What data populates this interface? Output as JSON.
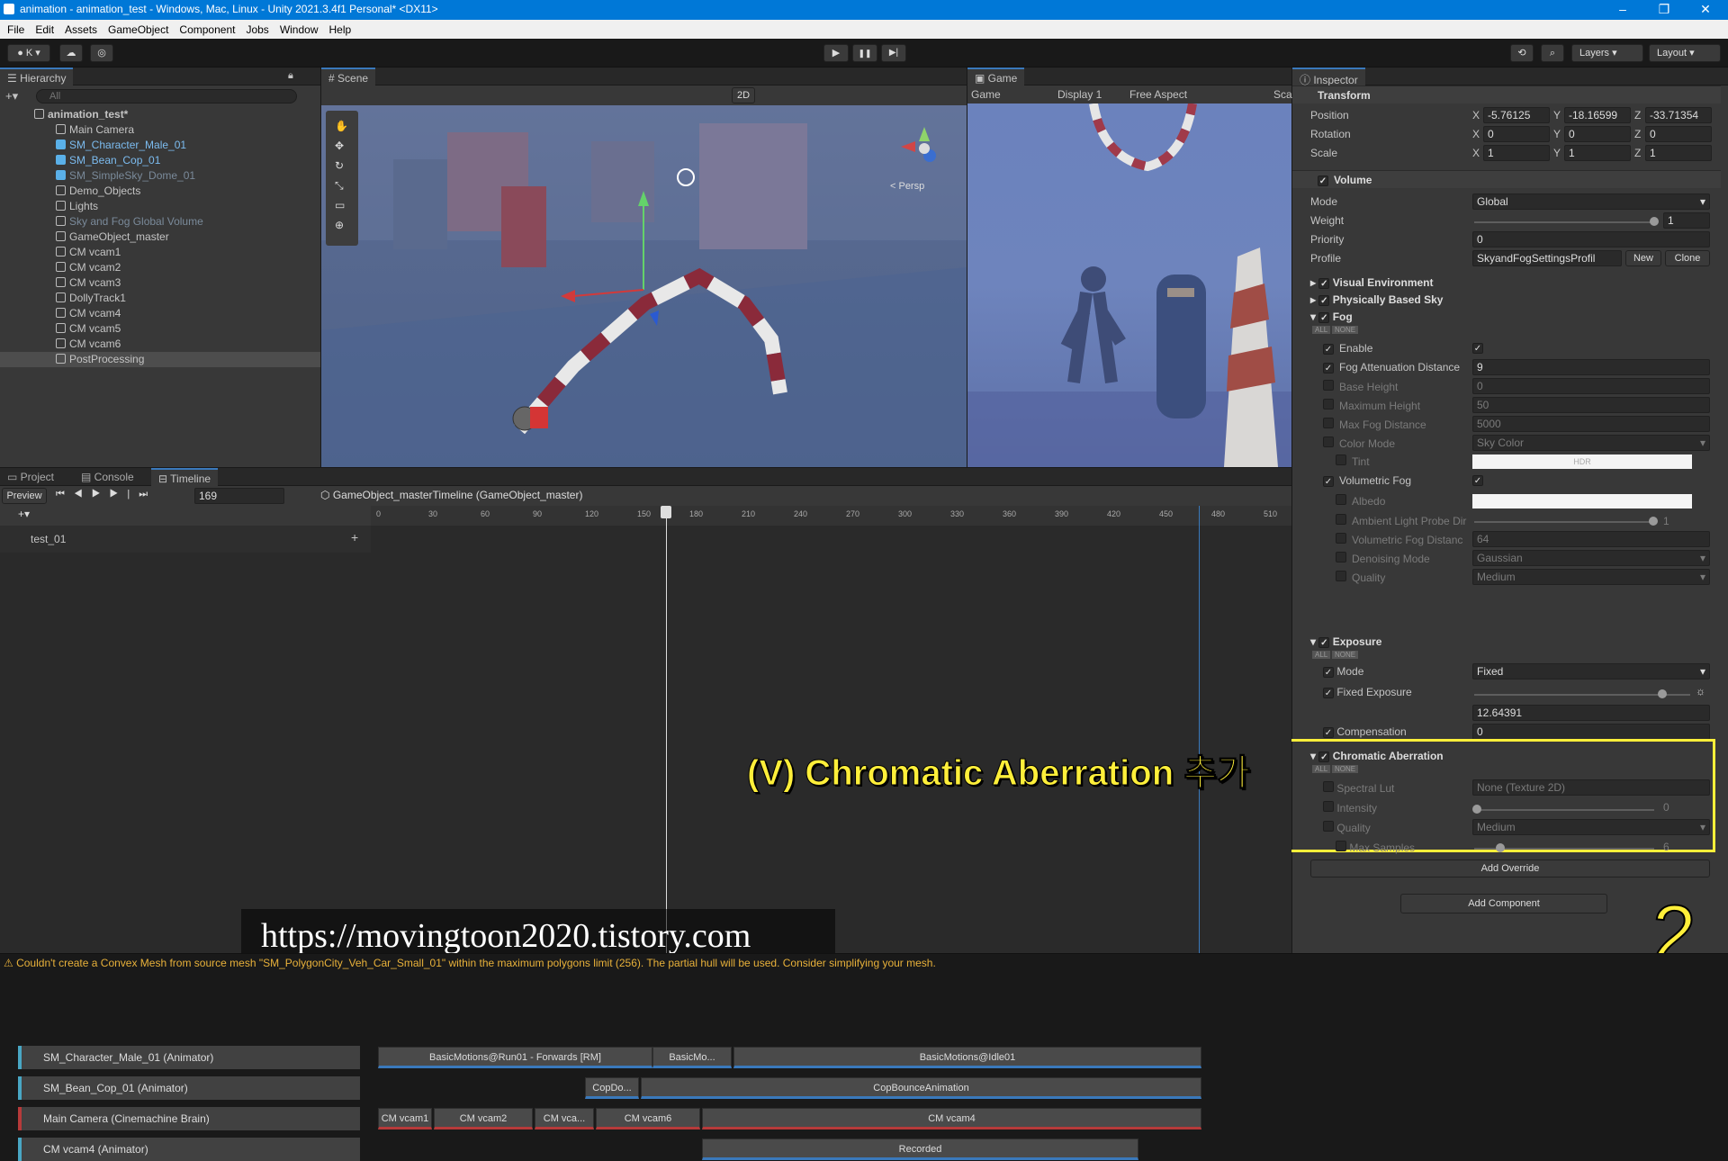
{
  "window": {
    "title": "animation - animation_test - Windows, Mac, Linux - Unity 2021.3.4f1 Personal* <DX11>",
    "min": "–",
    "max": "❐",
    "close": "✕"
  },
  "menu": [
    "File",
    "Edit",
    "Assets",
    "GameObject",
    "Component",
    "Jobs",
    "Window",
    "Help"
  ],
  "toolbar": {
    "account": "K",
    "layers": "Layers",
    "layout": "Layout",
    "play": "▶",
    "pause": "❚❚",
    "step": "▶|"
  },
  "hierarchy": {
    "tab": "Hierarchy",
    "search_placeholder": "All",
    "items": [
      {
        "label": "animation_test*",
        "indent": 0,
        "type": "scene"
      },
      {
        "label": "Main Camera",
        "indent": 1
      },
      {
        "label": "SM_Character_Male_01",
        "indent": 1,
        "prefab": true
      },
      {
        "label": "SM_Bean_Cop_01",
        "indent": 1,
        "prefab": true
      },
      {
        "label": "SM_SimpleSky_Dome_01",
        "indent": 1,
        "prefab": true,
        "dim": true
      },
      {
        "label": "Demo_Objects",
        "indent": 1
      },
      {
        "label": "Lights",
        "indent": 1
      },
      {
        "label": "Sky and Fog Global Volume",
        "indent": 1,
        "dim": true
      },
      {
        "label": "GameObject_master",
        "indent": 1
      },
      {
        "label": "CM vcam1",
        "indent": 1
      },
      {
        "label": "CM vcam2",
        "indent": 1
      },
      {
        "label": "CM vcam3",
        "indent": 1
      },
      {
        "label": "DollyTrack1",
        "indent": 1
      },
      {
        "label": "CM vcam4",
        "indent": 1
      },
      {
        "label": "CM vcam5",
        "indent": 1
      },
      {
        "label": "CM vcam6",
        "indent": 1
      },
      {
        "label": "PostProcessing",
        "indent": 1,
        "selected": true
      }
    ]
  },
  "scene": {
    "tab": "Scene",
    "mode2d": "2D",
    "persp": "< Persp"
  },
  "game": {
    "tab": "Game",
    "dropdown": "Game",
    "display": "Display 1",
    "aspect": "Free Aspect",
    "scale": "Sca"
  },
  "bottom_tabs": {
    "project": "Project",
    "console": "Console",
    "timeline": "Timeline"
  },
  "timeline": {
    "preview": "Preview",
    "frame": "169",
    "asset": "GameObject_masterTimeline (GameObject_master)",
    "ruler": [
      "0",
      "30",
      "60",
      "90",
      "120",
      "150",
      "180",
      "210",
      "240",
      "270",
      "300",
      "330",
      "360",
      "390",
      "420",
      "450",
      "480",
      "510"
    ],
    "group": "test_01",
    "tracks": [
      {
        "name": "SM_Character_Male_01 (Animator)",
        "clips": [
          "BasicMotions@Run01 - Forwards [RM]",
          "BasicMo...",
          "BasicMotions@Idle01"
        ]
      },
      {
        "name": "SM_Bean_Cop_01 (Animator)",
        "clips": [
          "CopDo...",
          "CopBounceAnimation"
        ]
      },
      {
        "name": "Main Camera (Cinemachine Brain)",
        "clips": [
          "CM vcam1",
          "CM vcam2",
          "CM vca...",
          "CM vcam6",
          "CM vcam4"
        ]
      },
      {
        "name": "CM vcam4 (Animator)",
        "clips": [
          "Recorded"
        ]
      }
    ]
  },
  "inspector": {
    "tab": "Inspector",
    "transform": {
      "title": "Transform",
      "position_label": "Position",
      "rotation_label": "Rotation",
      "scale_label": "Scale",
      "pos": [
        "-5.76125",
        "-18.16599",
        "-33.71354"
      ],
      "rot": [
        "0",
        "0",
        "0"
      ],
      "scl": [
        "1",
        "1",
        "1"
      ]
    },
    "volume": {
      "title": "Volume",
      "mode_label": "Mode",
      "mode": "Global",
      "weight_label": "Weight",
      "weight": "1",
      "priority_label": "Priority",
      "priority": "0",
      "profile_label": "Profile",
      "profile": "SkyandFogSettingsProfil",
      "new": "New",
      "clone": "Clone"
    },
    "overrides": {
      "visual_env": "Visual Environment",
      "pbs": "Physically Based Sky",
      "fog": "Fog",
      "all": "ALL",
      "none": "NONE"
    },
    "fog": [
      {
        "label": "Enable",
        "value": "✓",
        "kind": "check",
        "on": true
      },
      {
        "label": "Fog Attenuation Distance",
        "value": "9",
        "on": true
      },
      {
        "label": "Base Height",
        "value": "0"
      },
      {
        "label": "Maximum Height",
        "value": "50"
      },
      {
        "label": "Max Fog Distance",
        "value": "5000"
      },
      {
        "label": "Color Mode",
        "value": "Sky Color",
        "kind": "drop"
      },
      {
        "label": "Tint",
        "value": "HDR",
        "kind": "color",
        "sub": true
      },
      {
        "label": "Volumetric Fog",
        "value": "✓",
        "kind": "check",
        "on": true
      },
      {
        "label": "Albedo",
        "value": "",
        "kind": "color",
        "sub": true
      },
      {
        "label": "Ambient Light Probe Dir",
        "value": "1",
        "kind": "slider",
        "sub": true
      },
      {
        "label": "Volumetric Fog Distanc",
        "value": "64",
        "sub": true
      },
      {
        "label": "Denoising Mode",
        "value": "Gaussian",
        "kind": "drop",
        "sub": true
      },
      {
        "label": "Quality",
        "value": "Medium",
        "kind": "drop",
        "sub": true
      }
    ],
    "exposure": {
      "title": "Exposure",
      "mode_label": "Mode",
      "mode": "Fixed",
      "fixed_label": "Fixed Exposure",
      "fixed": "12.64391",
      "comp_label": "Compensation",
      "comp": "0"
    },
    "chromatic": {
      "title": "Chromatic Aberration",
      "lut_label": "Spectral Lut",
      "lut": "None (Texture 2D)",
      "int_label": "Intensity",
      "int": "0",
      "quality_label": "Quality",
      "quality": "Medium",
      "samples_label": "Max Samples",
      "samples": "6"
    },
    "add_override": "Add Override",
    "add_component": "Add Component"
  },
  "overlay": {
    "caption": "(V) Chromatic Aberration 추가",
    "url": "https://movingtoon2020.tistory.com",
    "number": "2",
    "highlight_color": "#ffef3a"
  },
  "statusbar": {
    "warning": "Couldn't create a Convex Mesh from source mesh \"SM_PolygonCity_Veh_Car_Small_01\" within the maximum polygons limit (256). The partial hull will be used. Consider simplifying your mesh."
  }
}
